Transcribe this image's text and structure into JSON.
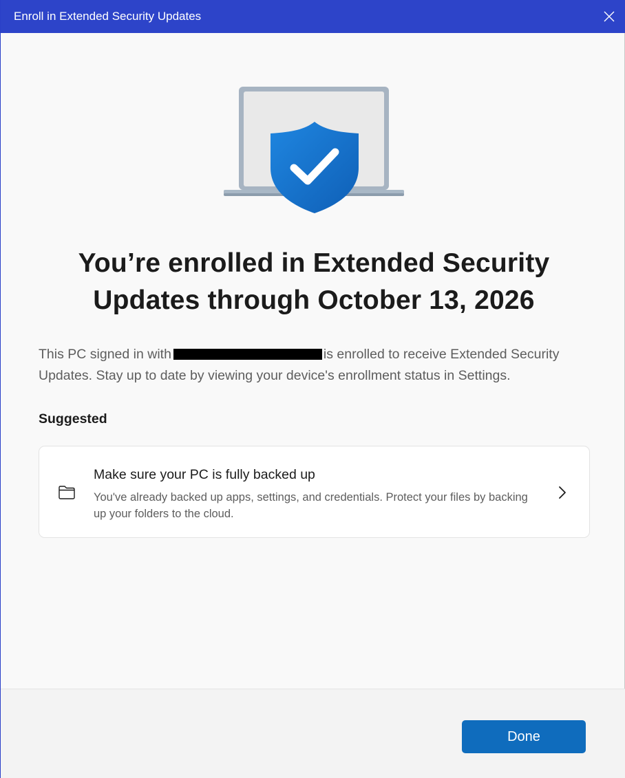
{
  "window": {
    "title": "Enroll in Extended Security Updates",
    "close_icon": "close-icon"
  },
  "hero": {
    "icon": "laptop-shield-check-icon",
    "shield_color": "#1976d2"
  },
  "headline": "You’re enrolled in Extended Security Updates through October 13, 2026",
  "description": {
    "before": "This PC signed in with",
    "redacted_account": true,
    "after": "is enrolled to receive Extended Security Updates. Stay up to date by viewing your device's enrollment status in Settings."
  },
  "suggested": {
    "heading": "Suggested",
    "card": {
      "icon": "folder-icon",
      "title": "Make sure your PC is fully backed up",
      "description": "You've already backed up apps, settings, and credentials. Protect your files by backing up your folders to the cloud.",
      "chevron": "chevron-right-icon"
    }
  },
  "footer": {
    "done_label": "Done"
  },
  "colors": {
    "titlebar": "#2d44c9",
    "accent": "#0f6cbd"
  }
}
